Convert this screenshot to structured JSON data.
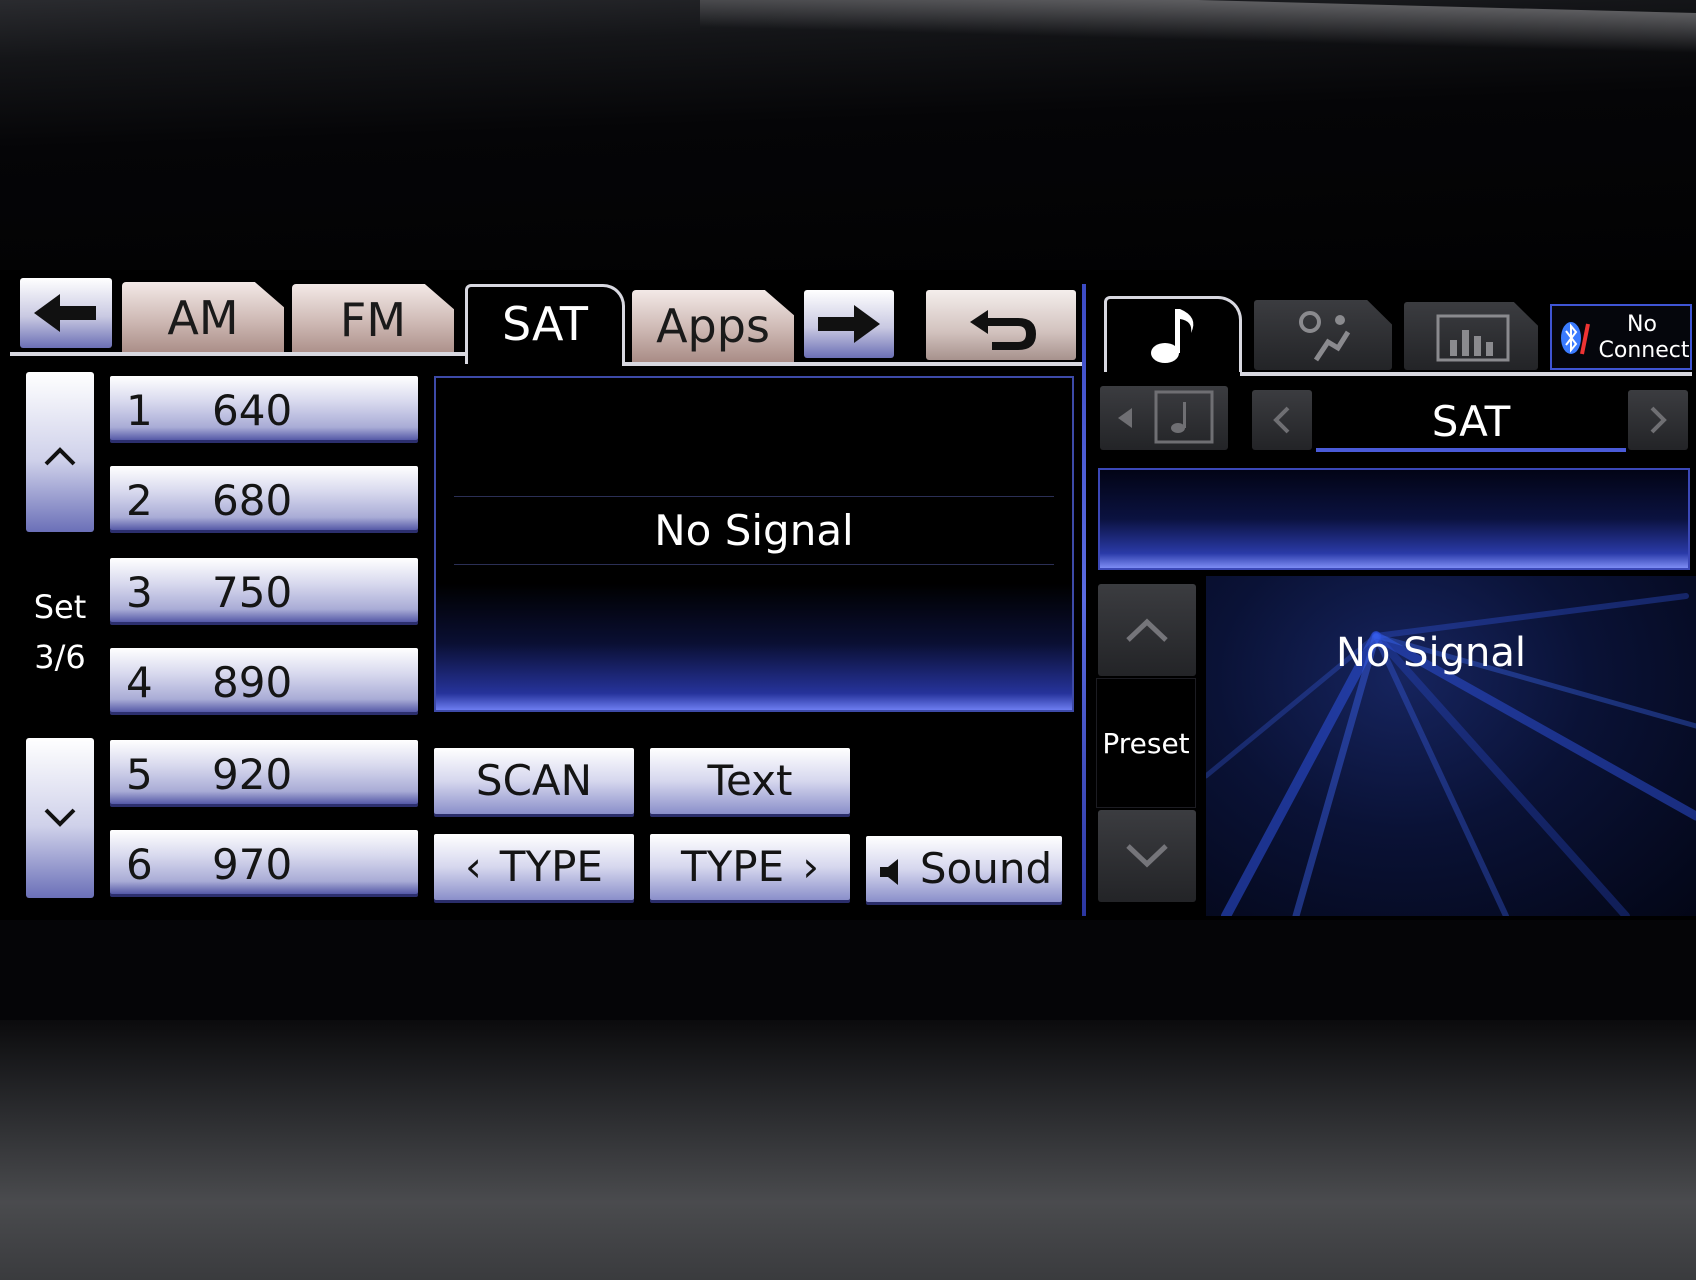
{
  "tabs": [
    {
      "label": "AM"
    },
    {
      "label": "FM"
    },
    {
      "label": "SAT",
      "active": true
    },
    {
      "label": "Apps"
    }
  ],
  "presets": [
    {
      "num": "1",
      "freq": "640"
    },
    {
      "num": "2",
      "freq": "680"
    },
    {
      "num": "3",
      "freq": "750"
    },
    {
      "num": "4",
      "freq": "890"
    },
    {
      "num": "5",
      "freq": "920"
    },
    {
      "num": "6",
      "freq": "970"
    }
  ],
  "preset_set": {
    "label": "Set",
    "page": "3/6"
  },
  "main": {
    "status": "No Signal"
  },
  "controls": {
    "scan": "SCAN",
    "text": "Text",
    "type_prev": "TYPE",
    "type_next": "TYPE",
    "sound": "Sound"
  },
  "right_panel": {
    "source": "SAT",
    "status": "No Signal",
    "preset_label": "Preset",
    "bluetooth_line1": "No",
    "bluetooth_line2": "Connect"
  },
  "icons": {
    "back": "left-arrow-icon",
    "forward": "right-arrow-icon",
    "return": "return-icon",
    "audio": "music-note-icon",
    "climate": "climate-fan-icon",
    "energy": "bar-graph-icon",
    "bluetooth": "bluetooth-icon"
  },
  "colors": {
    "accent_blue": "#4a5bd8",
    "tab_tan": "#cdb8b3",
    "button_lavender": "#d6d7ee"
  }
}
